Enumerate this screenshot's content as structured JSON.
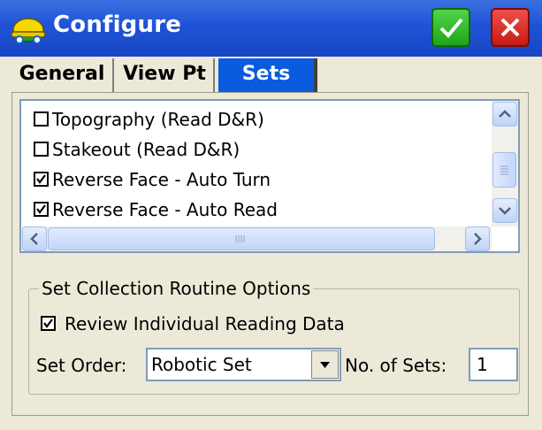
{
  "window": {
    "title": "Configure",
    "icon": "hardhat-icon",
    "ok_icon": "checkmark-icon",
    "close_icon": "close-x-icon",
    "accent_color": "#1f53d6"
  },
  "tabs": [
    {
      "label": "General",
      "selected": false
    },
    {
      "label": "View Pt",
      "selected": false
    },
    {
      "label": "Sets",
      "selected": true
    }
  ],
  "list": {
    "items": [
      {
        "label": "Topography (Read D&R)",
        "checked": false
      },
      {
        "label": "Stakeout (Read D&R)",
        "checked": false
      },
      {
        "label": "Reverse Face - Auto Turn",
        "checked": true
      },
      {
        "label": "Reverse Face - Auto Read",
        "checked": true
      }
    ]
  },
  "options": {
    "group_title": "Set Collection Routine Options",
    "review_label": "Review Individual Reading Data",
    "review_checked": true,
    "set_order_label": "Set Order:",
    "set_order_value": "Robotic Set",
    "num_sets_label": "No. of Sets:",
    "num_sets_value": "1"
  }
}
